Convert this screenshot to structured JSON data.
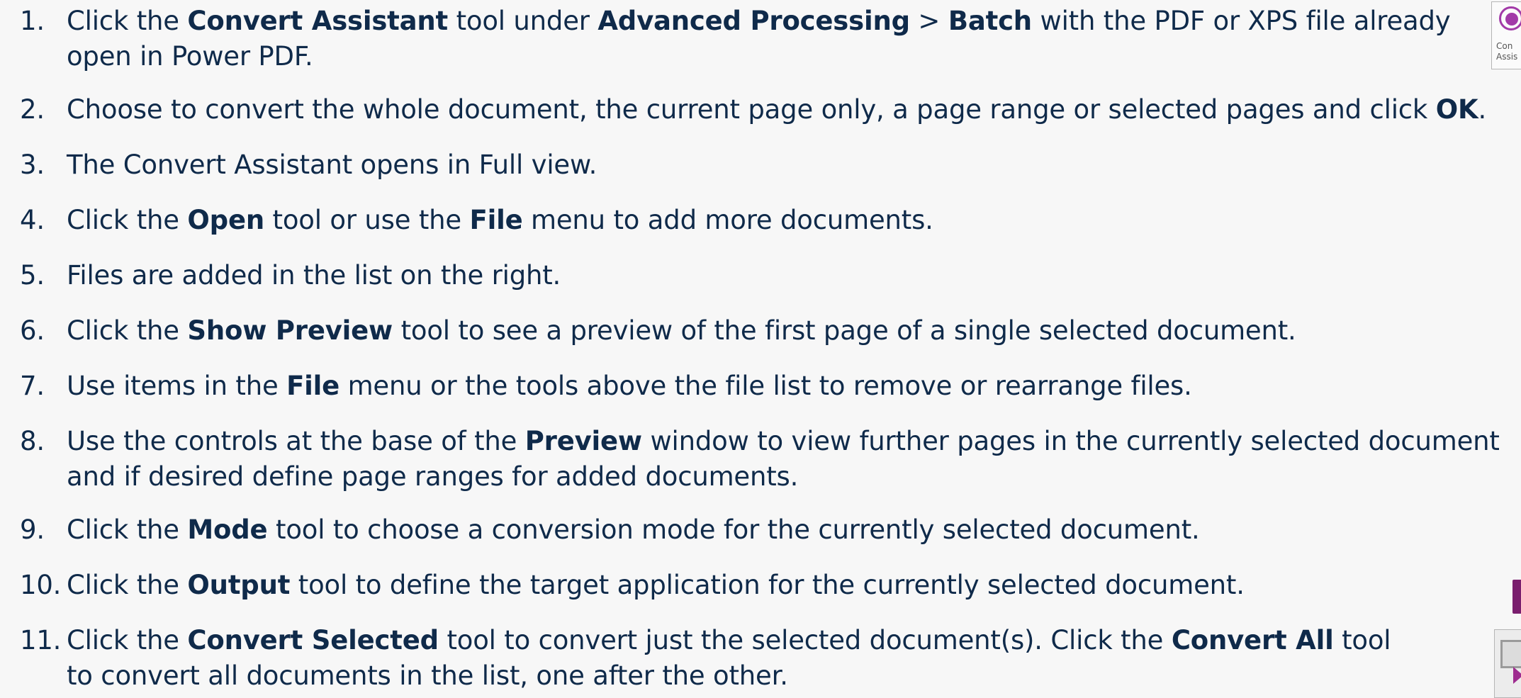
{
  "steps": [
    {
      "num": "1.",
      "lines": [
        [
          {
            "t": "Click the "
          },
          {
            "t": "Convert Assistant",
            "b": true
          },
          {
            "t": " tool under "
          },
          {
            "t": "Advanced Processing",
            "b": true
          },
          {
            "t": " > "
          },
          {
            "t": "Batch",
            "b": true
          },
          {
            "t": " with the PDF or XPS file already"
          }
        ],
        [
          {
            "t": "open in Power PDF."
          }
        ]
      ]
    },
    {
      "num": "2.",
      "lines": [
        [
          {
            "t": "Choose to convert the whole document, the current page only, a page range or selected pages and click "
          },
          {
            "t": "OK",
            "b": true
          },
          {
            "t": "."
          }
        ]
      ]
    },
    {
      "num": "3.",
      "lines": [
        [
          {
            "t": "The Convert Assistant opens in Full view."
          }
        ]
      ]
    },
    {
      "num": "4.",
      "lines": [
        [
          {
            "t": "Click the "
          },
          {
            "t": "Open",
            "b": true
          },
          {
            "t": " tool or use the "
          },
          {
            "t": "File",
            "b": true
          },
          {
            "t": " menu to add more documents."
          }
        ]
      ]
    },
    {
      "num": "5.",
      "lines": [
        [
          {
            "t": "Files are added in the list on the right."
          }
        ]
      ]
    },
    {
      "num": "6.",
      "lines": [
        [
          {
            "t": "Click the "
          },
          {
            "t": "Show Preview",
            "b": true
          },
          {
            "t": " tool to see a preview of the first page of a single selected document."
          }
        ]
      ]
    },
    {
      "num": "7.",
      "lines": [
        [
          {
            "t": "Use items in the "
          },
          {
            "t": "File",
            "b": true
          },
          {
            "t": " menu or the tools above the file list to remove or rearrange files."
          }
        ]
      ]
    },
    {
      "num": "8.",
      "lines": [
        [
          {
            "t": "Use the controls at the base of the "
          },
          {
            "t": "Preview",
            "b": true
          },
          {
            "t": " window to view further pages in the currently selected document"
          }
        ],
        [
          {
            "t": "and if desired define page ranges for added documents."
          }
        ]
      ]
    },
    {
      "num": "9.",
      "lines": [
        [
          {
            "t": "Click the "
          },
          {
            "t": "Mode",
            "b": true
          },
          {
            "t": " tool to choose a conversion mode for the currently selected document."
          }
        ]
      ]
    },
    {
      "num": "10.",
      "lines": [
        [
          {
            "t": "Click the "
          },
          {
            "t": "Output",
            "b": true
          },
          {
            "t": " tool to define the target application for the currently selected document."
          }
        ]
      ]
    },
    {
      "num": "11.",
      "lines": [
        [
          {
            "t": "Click the "
          },
          {
            "t": "Convert Selected",
            "b": true
          },
          {
            "t": " tool to convert just the selected document(s). Click the "
          },
          {
            "t": "Convert All",
            "b": true
          },
          {
            "t": " tool"
          }
        ],
        [
          {
            "t": "to convert all documents in the list, one after the other."
          }
        ]
      ]
    }
  ],
  "thumbnails": {
    "convert_assistant": {
      "icon": "convert-assistant-icon",
      "caption_line1": "Con",
      "caption_line2": "Assis"
    },
    "output": {
      "icon": "output-icon"
    },
    "convert_selected": {
      "icon": "convert-selected-icon"
    }
  },
  "colors": {
    "text": "#0f2a4a",
    "background": "#f7f7f7",
    "accent": "#a23aa8"
  }
}
